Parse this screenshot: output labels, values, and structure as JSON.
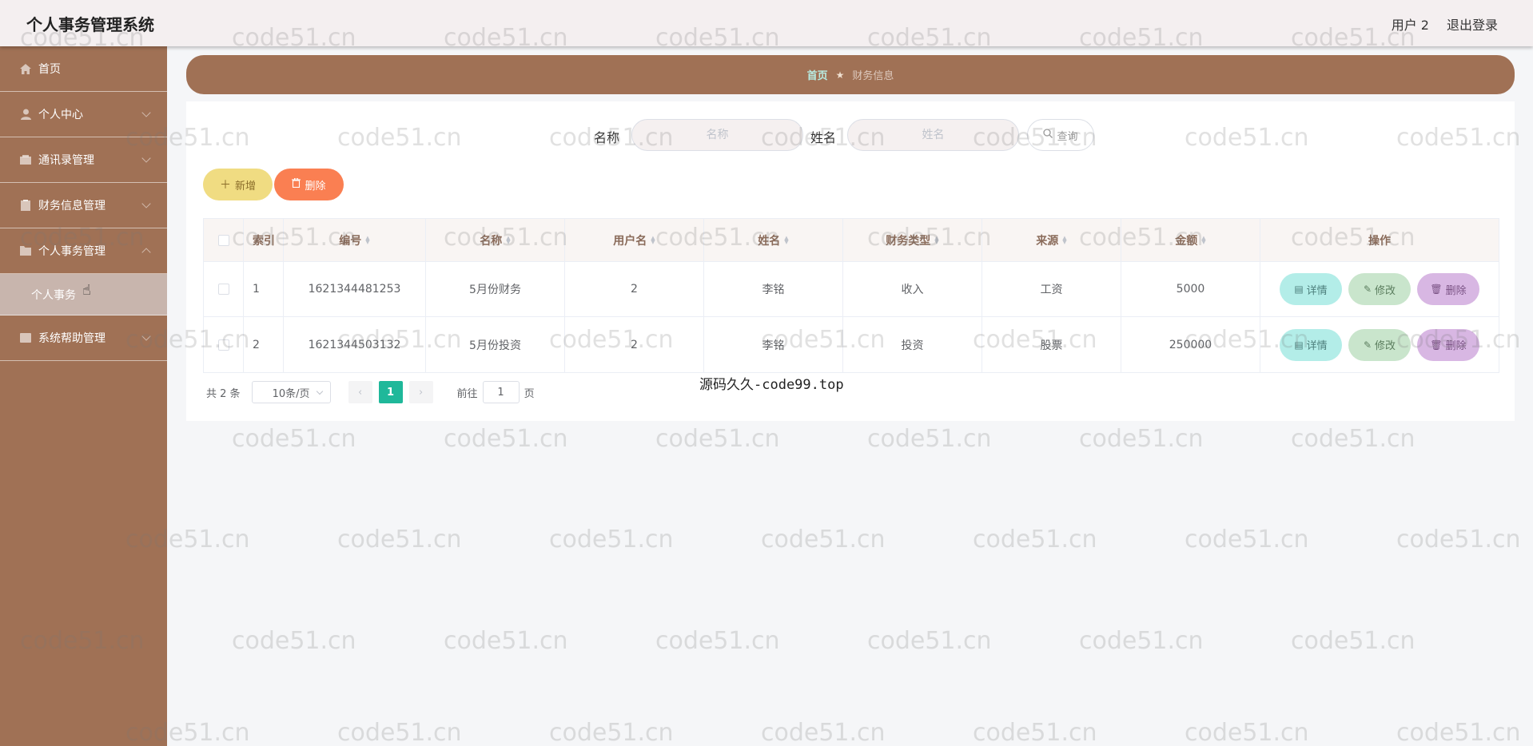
{
  "header": {
    "app_title": "个人事务管理系统",
    "user_label": "用户 2",
    "logout_label": "退出登录"
  },
  "sidebar": {
    "items": [
      {
        "label": "首页",
        "icon": "home-icon"
      },
      {
        "label": "个人中心",
        "icon": "user-icon"
      },
      {
        "label": "通讯录管理",
        "icon": "contacts-icon"
      },
      {
        "label": "财务信息管理",
        "icon": "finance-icon"
      },
      {
        "label": "个人事务管理",
        "icon": "folder-icon"
      },
      {
        "label": "系统帮助管理",
        "icon": "help-icon"
      }
    ],
    "active_sub": "个人事务"
  },
  "breadcrumb": {
    "home": "首页",
    "current": "财务信息"
  },
  "search": {
    "name_label": "名称",
    "name_placeholder": "名称",
    "real_label": "姓名",
    "real_placeholder": "姓名",
    "query_label": "查询"
  },
  "toolbar": {
    "add_label": "新增",
    "delete_label": "删除"
  },
  "table": {
    "headers": {
      "index": "索引",
      "code": "编号",
      "name": "名称",
      "user": "用户名",
      "real": "姓名",
      "type": "财务类型",
      "source": "来源",
      "amount": "金额",
      "ops": "操作"
    },
    "rows": [
      {
        "index": "1",
        "code": "1621344481253",
        "name": "5月份财务",
        "user": "2",
        "real": "李铭",
        "type": "收入",
        "source": "工资",
        "amount": "5000"
      },
      {
        "index": "2",
        "code": "1621344503132",
        "name": "5月份投资",
        "user": "2",
        "real": "李铭",
        "type": "投资",
        "source": "股票",
        "amount": "250000"
      }
    ],
    "ops": {
      "detail": "详情",
      "edit": "修改",
      "delete": "删除"
    }
  },
  "pagination": {
    "total": "共 2 条",
    "page_size": "10条/页",
    "current": "1",
    "goto_label": "前往",
    "goto_value": "1",
    "page_unit": "页"
  },
  "center_mark": "源码久久-code99.top",
  "watermark": "code51.cn"
}
